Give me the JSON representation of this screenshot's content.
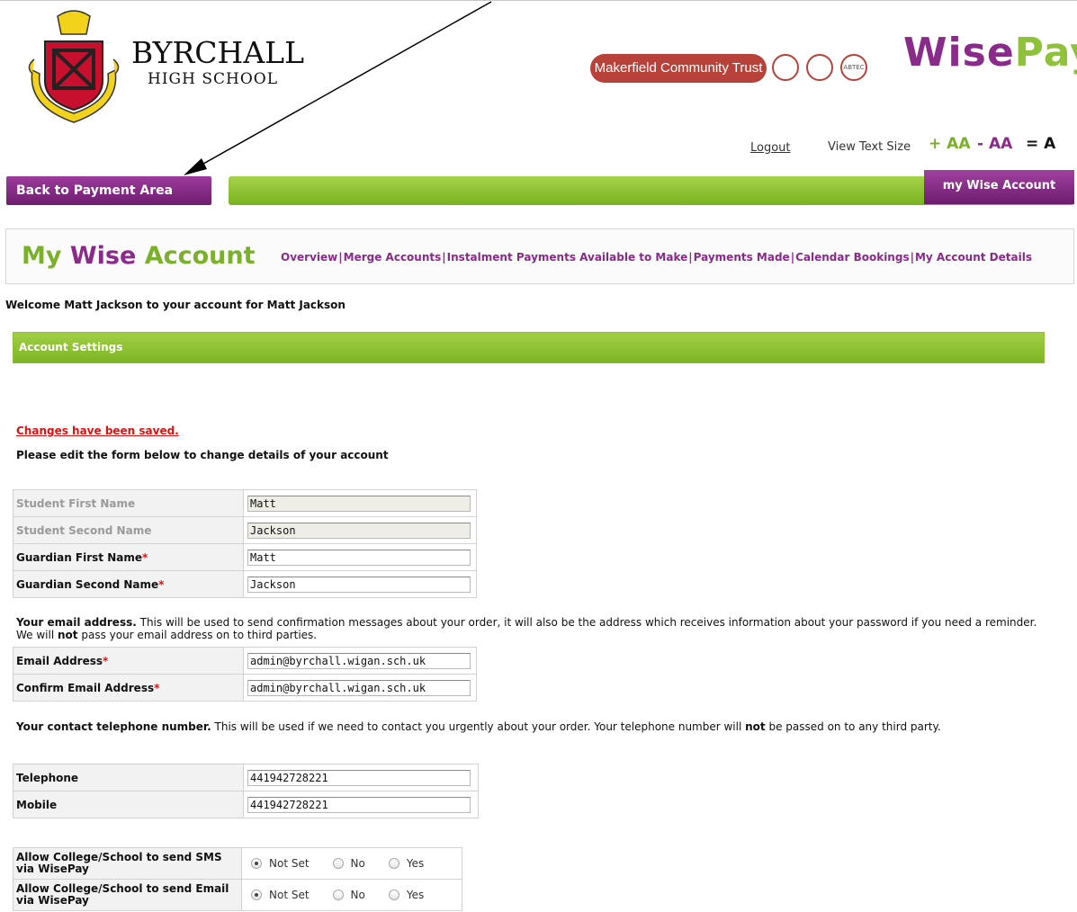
{
  "header": {
    "school_name": "BYRCHALL",
    "school_sub": "HIGH SCHOOL",
    "trust_name": "Makerfield Community Trust",
    "trust_logo_3": "ABTEC",
    "wisepay_a": "W",
    "wisepay_b": "ise",
    "wisepay_c": "Pay",
    "logout": "Logout",
    "view_text_size": "View Text Size",
    "size_plus": "+ AA",
    "size_minus": "- AA",
    "size_equal": "= A"
  },
  "nav": {
    "back_button": "Back to Payment Area",
    "wise_account_tab": "my Wise Account",
    "account_logo_a": "My ",
    "account_logo_b": "Wise",
    "account_logo_c": " Account",
    "links": [
      "Overview",
      "Merge Accounts",
      "Instalment Payments Available to Make",
      "Payments Made",
      "Calendar Bookings",
      "My Account Details"
    ],
    "separator": "|"
  },
  "page": {
    "welcome": "Welcome Matt Jackson to your account for Matt Jackson",
    "section_title": "Account Settings",
    "saved_message": "Changes have been saved.",
    "edit_note": "Please edit the form below to change details of your account"
  },
  "names": {
    "student_first_label": "Student First Name",
    "student_first_value": "Matt",
    "student_second_label": "Student Second Name",
    "student_second_value": "Jackson",
    "guardian_first_label": "Guardian First Name",
    "guardian_first_value": "Matt",
    "guardian_second_label": "Guardian Second Name",
    "guardian_second_value": "Jackson",
    "required_mark": "*"
  },
  "email": {
    "intro_bold": "Your email address.",
    "intro_rest": " This will be used to send confirmation messages about your order, it will also be the address which receives information about your password if you need a reminder. We will ",
    "intro_not": "not",
    "intro_end": " pass your email address on to third parties.",
    "email_label": "Email Address",
    "email_value": "admin@byrchall.wigan.sch.uk",
    "confirm_label": "Confirm Email Address",
    "confirm_value": "admin@byrchall.wigan.sch.uk"
  },
  "phone": {
    "intro_bold": "Your contact telephone number.",
    "intro_rest": " This will be used if we need to contact you urgently about your order. Your telephone number will ",
    "intro_not": "not",
    "intro_end": " be passed on to any third party.",
    "telephone_label": "Telephone",
    "telephone_value": "441942728221",
    "mobile_label": "Mobile",
    "mobile_value": "441942728221"
  },
  "permissions": {
    "sms_label": "Allow College/School to send SMS via WisePay",
    "email_label": "Allow College/School to send Email via WisePay",
    "opt_not_set": "Not Set",
    "opt_no": "No",
    "opt_yes": "Yes",
    "sms_selected": "Not Set",
    "email_selected": "Not Set"
  },
  "colors": {
    "purple": "#8a2a8a",
    "green": "#8fc23a",
    "trust_red": "#b8423a",
    "error_red": "#e01010"
  }
}
